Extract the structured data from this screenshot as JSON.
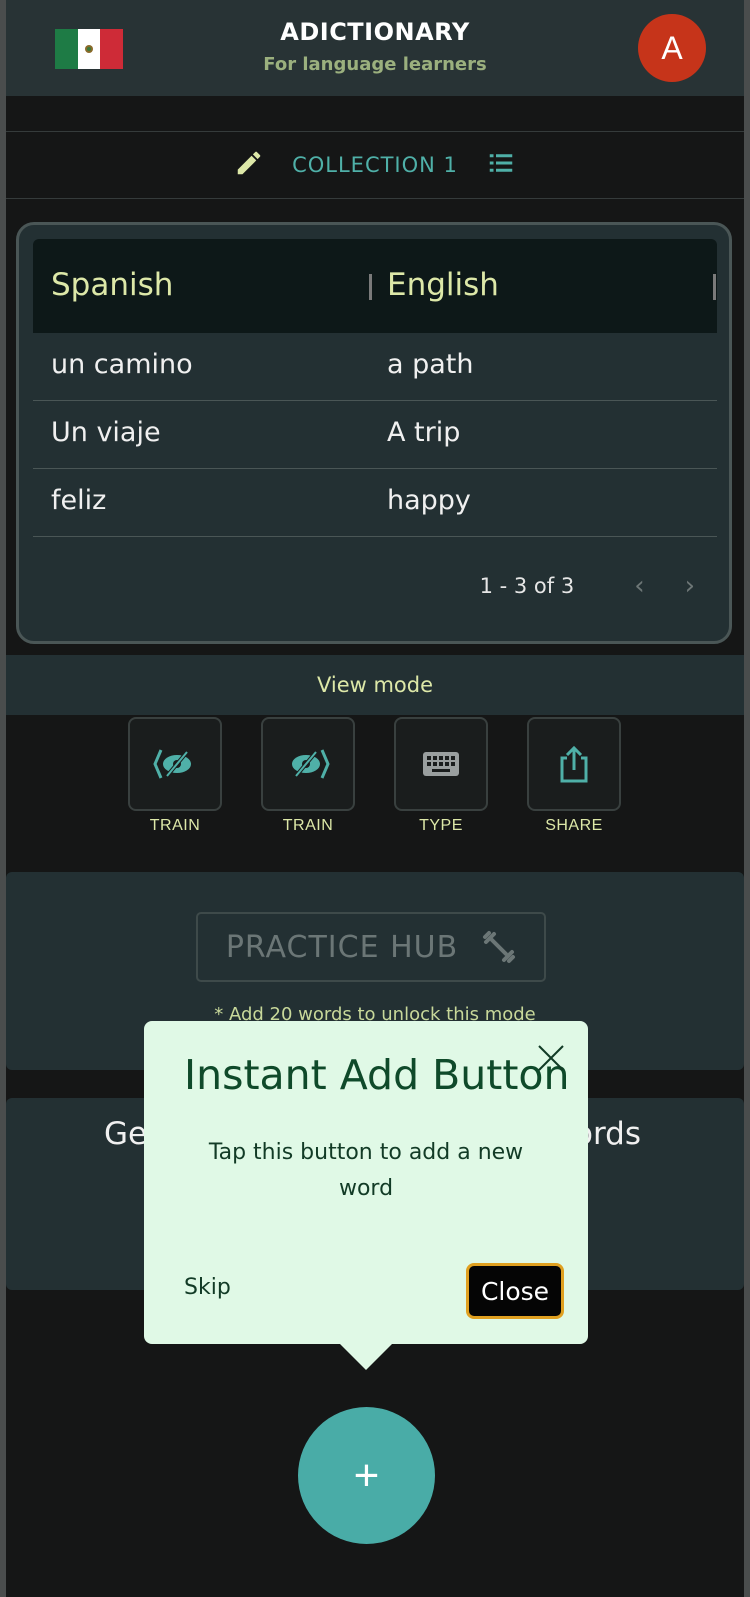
{
  "header": {
    "flag_colors": [
      "#1e7b45",
      "#ffffff",
      "#ce2b37"
    ],
    "title": "ADICTIONARY",
    "subtitle": "For language learners",
    "avatar_letter": "A"
  },
  "collection": {
    "name": "COLLECTION 1",
    "edit_icon": "pencil-icon",
    "list_icon": "list-icon"
  },
  "table": {
    "headers": [
      "Spanish",
      "English"
    ],
    "rows": [
      [
        "un camino",
        "a path"
      ],
      [
        "Un viaje",
        "A trip"
      ],
      [
        "feliz",
        "happy"
      ]
    ],
    "pagination": "1 - 3 of 3"
  },
  "view_mode": {
    "label": "View mode",
    "modes": [
      {
        "label": "TRAIN",
        "icon": "hide-left-icon"
      },
      {
        "label": "TRAIN",
        "icon": "hide-right-icon"
      },
      {
        "label": "TYPE",
        "icon": "keyboard-icon"
      },
      {
        "label": "SHARE",
        "icon": "share-icon"
      }
    ]
  },
  "practice": {
    "button_label": "PRACTICE HUB",
    "note": "* Add 20 words to unlock this mode"
  },
  "get_words": {
    "text_left": "Ge",
    "text_right": "ords"
  },
  "popover": {
    "title": "Instant Add Button",
    "body": "Tap this button to add a new word",
    "skip": "Skip",
    "close": "Close"
  },
  "fab": {
    "label": "+"
  },
  "colors": {
    "accent": "#49aca7",
    "header_bg": "#283335",
    "card_bg": "#233033",
    "label_yellow": "#dde8a8"
  }
}
